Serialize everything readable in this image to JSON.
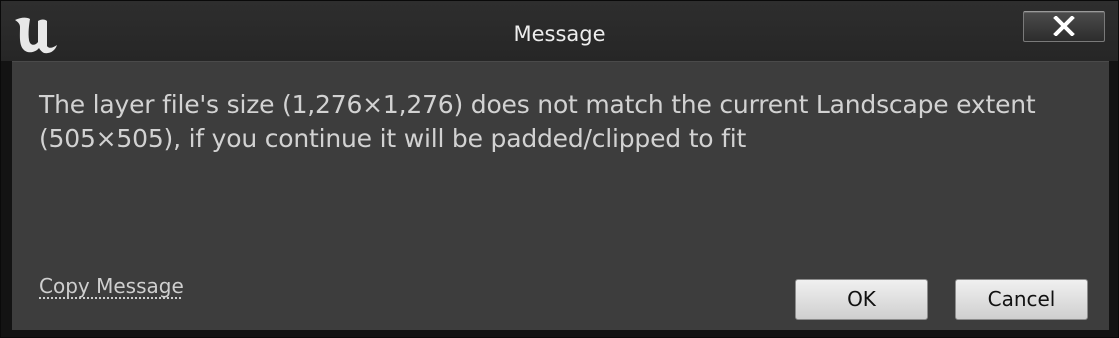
{
  "window": {
    "title": "Message",
    "logo_icon": "unreal-engine-logo",
    "close_icon": "close-icon"
  },
  "message": {
    "text": "The layer file's size (1,276×1,276) does not match the current Landscape extent (505×505), if you continue it will be padded/clipped to fit"
  },
  "actions": {
    "copy_message_label": "Copy Message",
    "ok_label": "OK",
    "cancel_label": "Cancel"
  },
  "colors": {
    "titlebar": "#2a2a2a",
    "content_background": "#3d3d3d",
    "text": "#d2d2d2",
    "button": "#e0e0e0"
  }
}
